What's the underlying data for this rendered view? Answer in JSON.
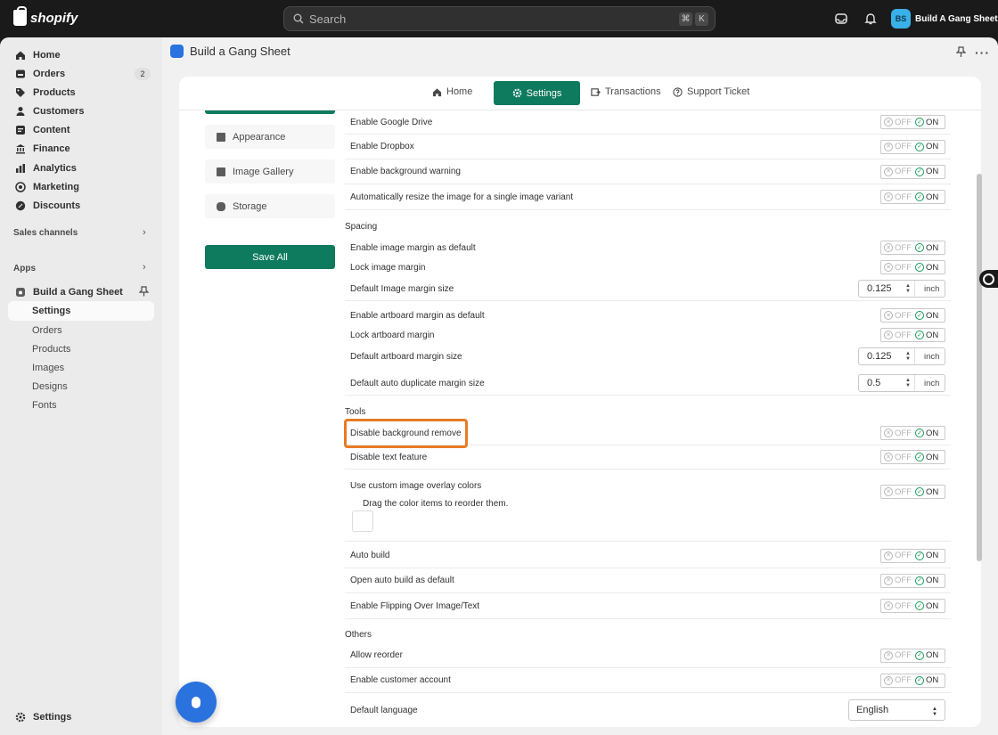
{
  "topbar": {
    "brand": "shopify",
    "search_placeholder": "Search",
    "kbd1": "⌘",
    "kbd2": "K",
    "avatar_initials": "BS",
    "store_name": "Build A Gang Sheet"
  },
  "sidebar": {
    "items": [
      {
        "label": "Home",
        "icon": "home-icon"
      },
      {
        "label": "Orders",
        "icon": "orders-icon",
        "badge": "2"
      },
      {
        "label": "Products",
        "icon": "tag-icon"
      },
      {
        "label": "Customers",
        "icon": "person-icon"
      },
      {
        "label": "Content",
        "icon": "content-icon"
      },
      {
        "label": "Finance",
        "icon": "bank-icon"
      },
      {
        "label": "Analytics",
        "icon": "bar-chart-icon"
      },
      {
        "label": "Marketing",
        "icon": "target-icon"
      },
      {
        "label": "Discounts",
        "icon": "discount-icon"
      }
    ],
    "sales_channels": "Sales channels",
    "apps": "Apps",
    "app_name": "Build a Gang Sheet",
    "app_subitems": [
      "Settings",
      "Orders",
      "Products",
      "Images",
      "Designs",
      "Fonts"
    ],
    "settings": "Settings"
  },
  "app_header": {
    "title": "Build a Gang Sheet"
  },
  "tabs": {
    "home": "Home",
    "settings": "Settings",
    "transactions": "Transactions",
    "support": "Support Ticket"
  },
  "left_menu": {
    "appearance": "Appearance",
    "gallery": "Image Gallery",
    "storage": "Storage",
    "save_all": "Save All"
  },
  "toggle": {
    "off": "OFF",
    "on": "ON"
  },
  "settings": {
    "google_drive": "Enable Google Drive",
    "dropbox": "Enable Dropbox",
    "bg_warning": "Enable background warning",
    "auto_resize": "Automatically resize the image for a single image variant",
    "spacing_title": "Spacing",
    "img_margin_default": "Enable image margin as default",
    "lock_img_margin": "Lock image margin",
    "default_img_margin": "Default Image margin size",
    "default_img_margin_value": "0.125",
    "artboard_margin_default": "Enable artboard margin as default",
    "lock_artboard_margin": "Lock artboard margin",
    "default_artboard_margin": "Default artboard margin size",
    "default_artboard_margin_value": "0.125",
    "auto_dup_margin": "Default auto duplicate margin size",
    "auto_dup_margin_value": "0.5",
    "unit": "inch",
    "tools_title": "Tools",
    "disable_bg_remove": "Disable background remove",
    "disable_text": "Disable text feature",
    "custom_overlay": "Use custom image overlay colors",
    "drag_hint": "Drag the color items to reorder them.",
    "auto_build": "Auto build",
    "open_auto_build": "Open auto build as default",
    "flipping": "Enable Flipping Over Image/Text",
    "others_title": "Others",
    "allow_reorder": "Allow reorder",
    "customer_account": "Enable customer account",
    "default_language": "Default language",
    "language_value": "English"
  },
  "colors": {
    "accent": "#0e7a5e",
    "highlight": "#e87b25",
    "app_blue": "#2a72de"
  }
}
